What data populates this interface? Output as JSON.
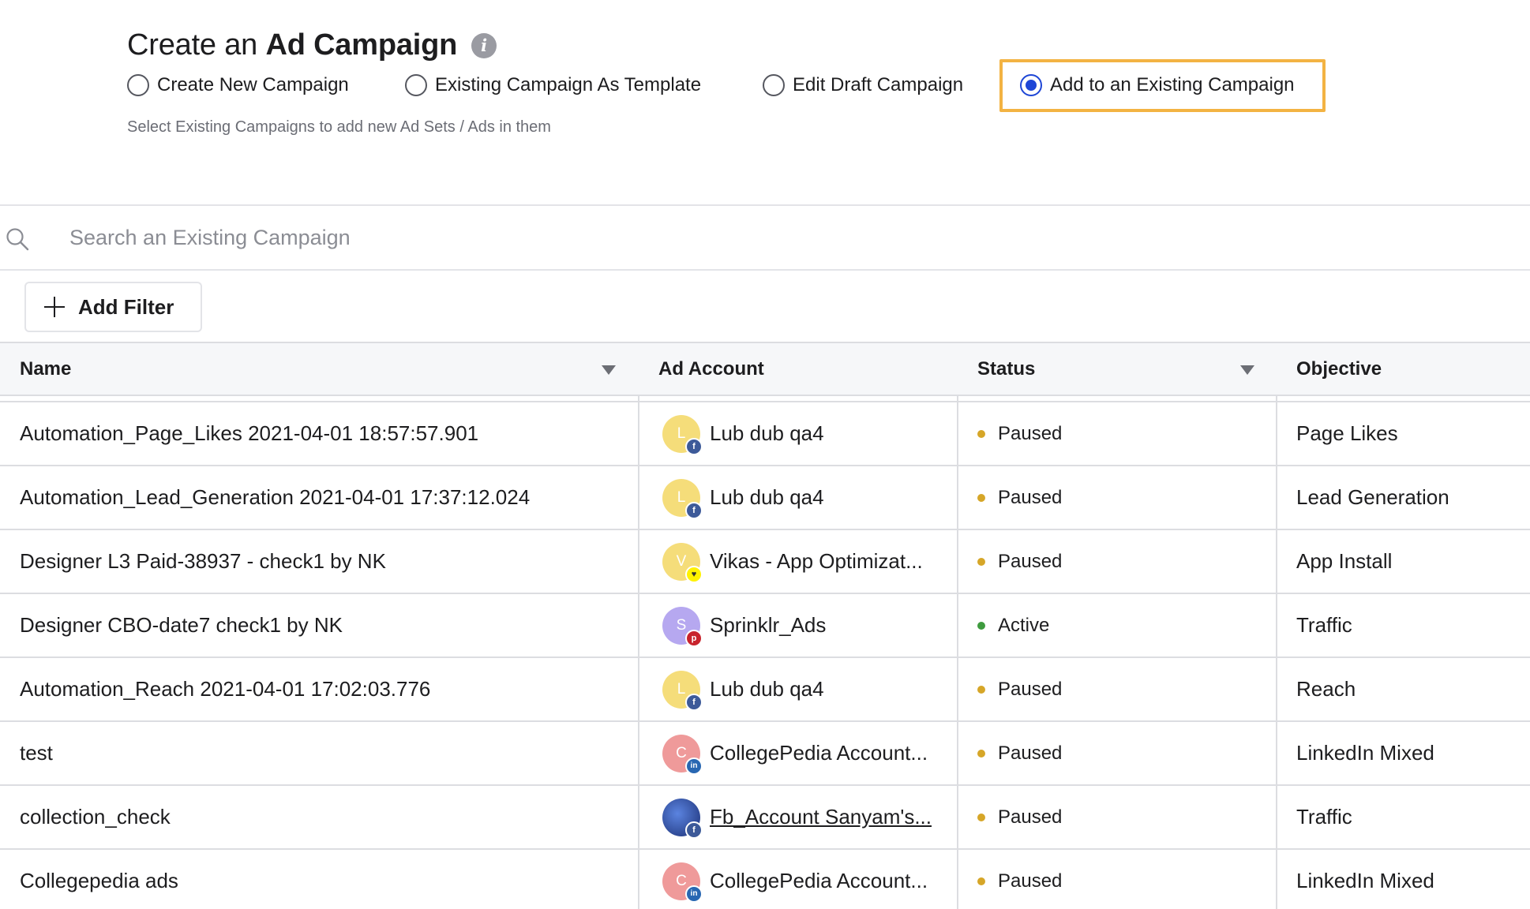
{
  "header": {
    "title_prefix": "Create an ",
    "title_bold": "Ad Campaign",
    "info_glyph": "i",
    "hint": "Select Existing Campaigns to add new Ad Sets / Ads in them"
  },
  "modes": [
    {
      "label": "Create New Campaign",
      "selected": false
    },
    {
      "label": "Existing Campaign As Template",
      "selected": false
    },
    {
      "label": "Edit Draft Campaign",
      "selected": false
    },
    {
      "label": "Add to an Existing Campaign",
      "selected": true
    }
  ],
  "search": {
    "placeholder": "Search an Existing Campaign",
    "value": ""
  },
  "filter": {
    "add_label": "Add Filter"
  },
  "table": {
    "columns": [
      "Name",
      "Ad Account",
      "Status",
      "Objective"
    ],
    "rows": [
      {
        "name": "Automation_Page_Likes 2021-04-01 18:57:57.901",
        "avatar": "L",
        "network": "facebook-icon",
        "account": "Lub dub qa4",
        "status": "Paused",
        "objective": "Page Likes"
      },
      {
        "name": "Automation_Lead_Generation 2021-04-01 17:37:12.024",
        "avatar": "L",
        "network": "facebook-icon",
        "account": "Lub dub qa4",
        "status": "Paused",
        "objective": "Lead Generation"
      },
      {
        "name": "Designer L3 Paid-38937 - check1 by NK",
        "avatar": "V",
        "network": "snapchat-icon",
        "account": "Vikas - App Optimizat...",
        "status": "Paused",
        "objective": "App Install"
      },
      {
        "name": "Designer CBO-date7 check1 by NK",
        "avatar": "S",
        "network": "pinterest-icon",
        "account": "Sprinklr_Ads",
        "status": "Active",
        "objective": "Traffic"
      },
      {
        "name": "Automation_Reach 2021-04-01 17:02:03.776",
        "avatar": "L",
        "network": "facebook-icon",
        "account": "Lub dub qa4",
        "status": "Paused",
        "objective": "Reach"
      },
      {
        "name": "test",
        "avatar": "C",
        "network": "linkedin-icon",
        "account": "CollegePedia Account...",
        "status": "Paused",
        "objective": "LinkedIn Mixed"
      },
      {
        "name": "collection_check",
        "avatar": "",
        "network": "facebook-icon",
        "account": "Fb_Account Sanyam's...",
        "status": "Paused",
        "objective": "Traffic"
      },
      {
        "name": "Collegepedia ads",
        "avatar": "C",
        "network": "linkedin-icon",
        "account": "CollegePedia Account...",
        "status": "Paused",
        "objective": "LinkedIn Mixed"
      }
    ]
  },
  "colors": {
    "accent": "#1e46d6",
    "selection_outline": "#f3b343",
    "paused": "#d6a628",
    "active": "#3e9b3e",
    "avatar_yellow": "#f5dd7a",
    "avatar_purple": "#b6a8f0",
    "avatar_pink": "#ef9a9a",
    "avatar_photo": "#2a4fa8"
  }
}
